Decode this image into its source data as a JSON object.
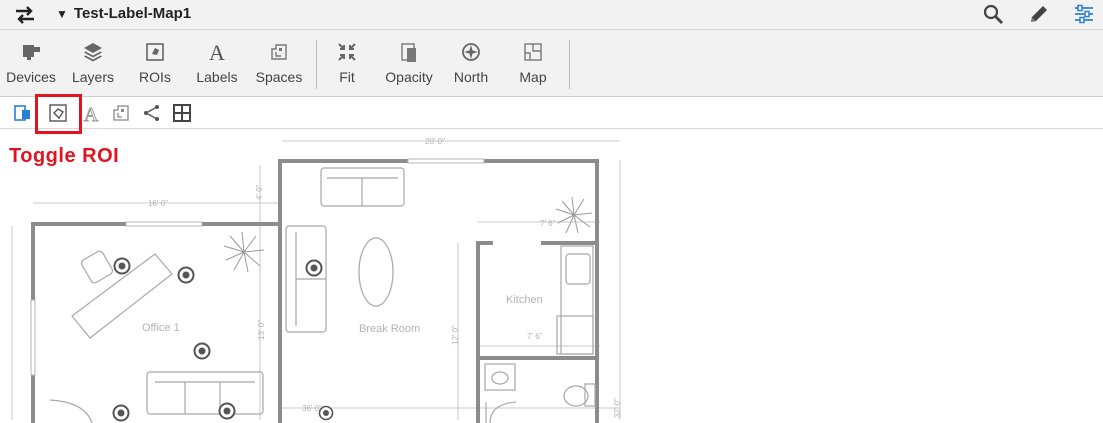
{
  "header": {
    "map_title": "Test-Label-Map1",
    "icons": [
      "swap-icon",
      "search-icon",
      "pencil-icon",
      "sliders-icon"
    ]
  },
  "toolbar": {
    "items": [
      {
        "label": "Devices",
        "icon": "devices-icon"
      },
      {
        "label": "Layers",
        "icon": "layers-icon"
      },
      {
        "label": "ROIs",
        "icon": "roi-icon"
      },
      {
        "label": "Labels",
        "icon": "labels-icon"
      },
      {
        "label": "Spaces",
        "icon": "spaces-icon"
      },
      {
        "label": "Fit",
        "icon": "fit-icon"
      },
      {
        "label": "Opacity",
        "icon": "opacity-icon"
      },
      {
        "label": "North",
        "icon": "north-icon"
      },
      {
        "label": "Map",
        "icon": "map-icon"
      }
    ]
  },
  "subtoolbar": {
    "icons": [
      "devices-toggle-icon",
      "roi-toggle-icon",
      "labels-toggle-icon",
      "spaces-toggle-icon",
      "share-icon",
      "grid-icon"
    ],
    "highlighted": "roi-toggle-icon"
  },
  "annotation": "Toggle ROI",
  "floorplan": {
    "rooms": {
      "office": "Office 1",
      "break_room": "Break Room",
      "kitchen": "Kitchen"
    },
    "dimensions": {
      "top": "20' 0\"",
      "office_width": "16' 0\"",
      "office_top_offset": "4' 0\"",
      "office_height": "13' 0\"",
      "kitchen_top": "7' 6\"",
      "kitchen_bottom": "7' 6\"",
      "kitchen_height": "12' 0\"",
      "bottom": "36' 0\"",
      "right": "32' 0\""
    }
  },
  "colors": {
    "accent_red": "#e1141f",
    "toolbar_bg": "#f2f2f2",
    "wall": "#8c8c8c",
    "device_icon": "#555555",
    "active_blue": "#2a7fd4"
  }
}
